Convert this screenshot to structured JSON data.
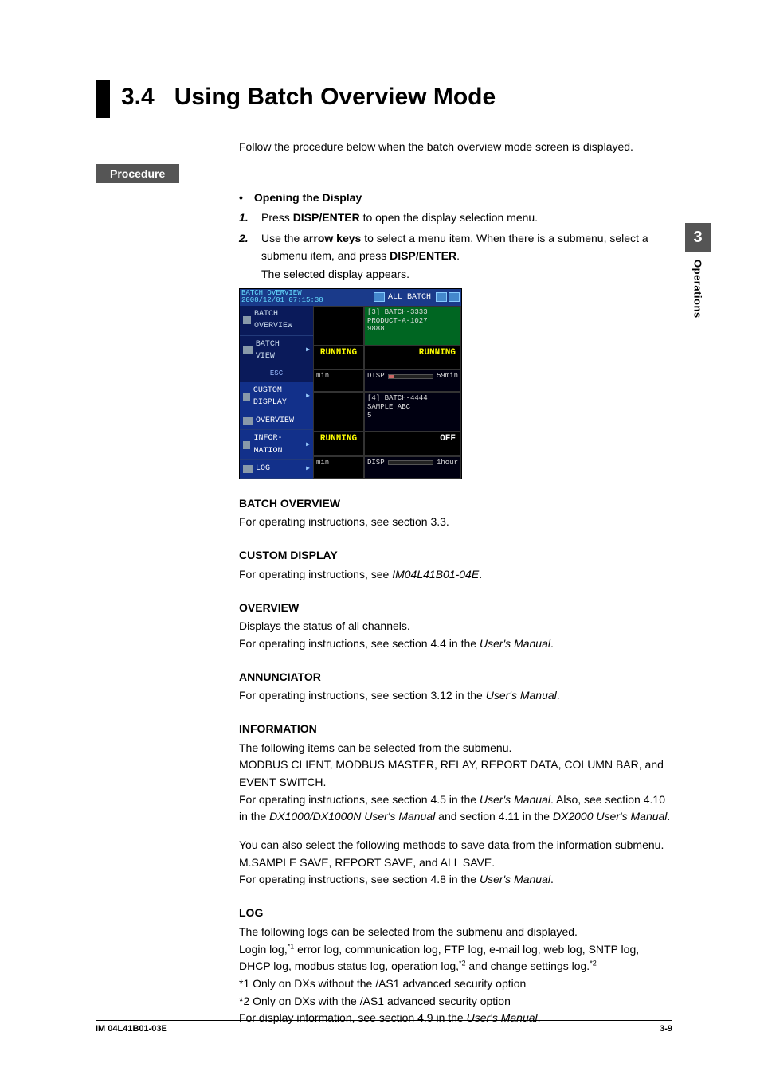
{
  "sideTab": {
    "num": "3",
    "label": "Operations"
  },
  "title": {
    "num": "3.4",
    "text": "Using Batch Overview Mode"
  },
  "intro": "Follow the procedure below when the batch overview mode screen is displayed.",
  "procLabel": "Procedure",
  "opening": {
    "head": "• Opening the Display",
    "steps": [
      {
        "n": "1.",
        "pre": "Press ",
        "b1": "DISP/ENTER",
        "post": " to open the display selection menu."
      },
      {
        "n": "2.",
        "pre": "Use the ",
        "b1": "arrow keys",
        "mid": " to select a menu item. When there is a submenu, select a submenu item, and press ",
        "b2": "DISP/ENTER",
        "post2": ".",
        "sub": "The selected display appears."
      }
    ]
  },
  "shot": {
    "title1": "BATCH OVERVIEW",
    "title2": "2008/12/01 07:15:38",
    "tab": "ALL BATCH",
    "side": [
      {
        "label": "BATCH OVERVIEW",
        "hl": false
      },
      {
        "label": "BATCH VIEW",
        "hl": false,
        "arrow": true
      },
      {
        "label": "ESC",
        "esc": true
      },
      {
        "label": "CUSTOM DISPLAY",
        "hl": true,
        "arrow": true
      },
      {
        "label": "OVERVIEW",
        "hl": true
      },
      {
        "label": "INFOR- MATION",
        "hl": true,
        "arrow": true
      },
      {
        "label": "LOG",
        "hl": true,
        "arrow": true
      }
    ],
    "cells": {
      "r1c2a": "[3] BATCH-3333",
      "r1c2b": "PRODUCT-A-1027",
      "r1c2c": "9888",
      "runL": "RUNNING",
      "runR": "RUNNING",
      "minL": "min",
      "dispR1a": "DISP",
      "dispR1b": "59min",
      "r3a": "[4] BATCH-4444",
      "r3b": "SAMPLE_ABC",
      "r3c": "5",
      "off": "OFF",
      "min2": "min",
      "disp2a": "DISP",
      "disp2b": "1hour"
    }
  },
  "sections": {
    "batchOverview": {
      "head": "BATCH OVERVIEW",
      "body": "For operating instructions, see section 3.3."
    },
    "custom": {
      "head": "CUSTOM DISPLAY",
      "b1": "For operating instructions, see ",
      "i1": "IM04L41B01-04E",
      "b2": "."
    },
    "overview": {
      "head": "OVERVIEW",
      "l1": "Displays the status of all channels.",
      "l2a": "For operating instructions, see section 4.4 in the ",
      "l2i": "User's Manual",
      "l2b": "."
    },
    "annun": {
      "head": "ANNUNCIATOR",
      "a": "For operating instructions, see section 3.12 in the ",
      "i": "User's Manual",
      "b": "."
    },
    "info": {
      "head": "INFORMATION",
      "p1": "The following items can be selected from the submenu.",
      "p2": "MODBUS CLIENT, MODBUS MASTER, RELAY, REPORT DATA, COLUMN BAR, and EVENT SWITCH.",
      "p3a": "For operating instructions, see section 4.5 in the ",
      "p3i1": "User's Manual",
      "p3b": ". Also, see section 4.10 in the ",
      "p3i2": "DX1000/DX1000N User's Manual",
      "p3c": " and section 4.11 in the ",
      "p3i3": "DX2000 User's Manual",
      "p3d": ".",
      "p4": "You can also select the following methods to save data from the information submenu. M.SAMPLE SAVE, REPORT SAVE, and ALL SAVE.",
      "p5a": "For operating instructions, see section 4.8 in the ",
      "p5i": "User's Manual",
      "p5b": "."
    },
    "log": {
      "head": "LOG",
      "l1": "The following logs can be selected from the submenu and displayed.",
      "l2a": "Login log,",
      "s1": "*1",
      "l2b": " error log, communication log, FTP log, e-mail log, web log, SNTP log, DHCP log, modbus status log, operation log,",
      "s2": "*2",
      "l2c": " and change settings log.",
      "s3": "*2",
      "n1": "*1 Only on DXs without the /AS1 advanced security option",
      "n2": "*2 Only on DXs with the /AS1 advanced security option",
      "l3a": "For display information, see section 4.9 in the ",
      "l3i": "User's Manual",
      "l3b": "."
    }
  },
  "footer": {
    "left": "IM 04L41B01-03E",
    "right": "3-9"
  }
}
